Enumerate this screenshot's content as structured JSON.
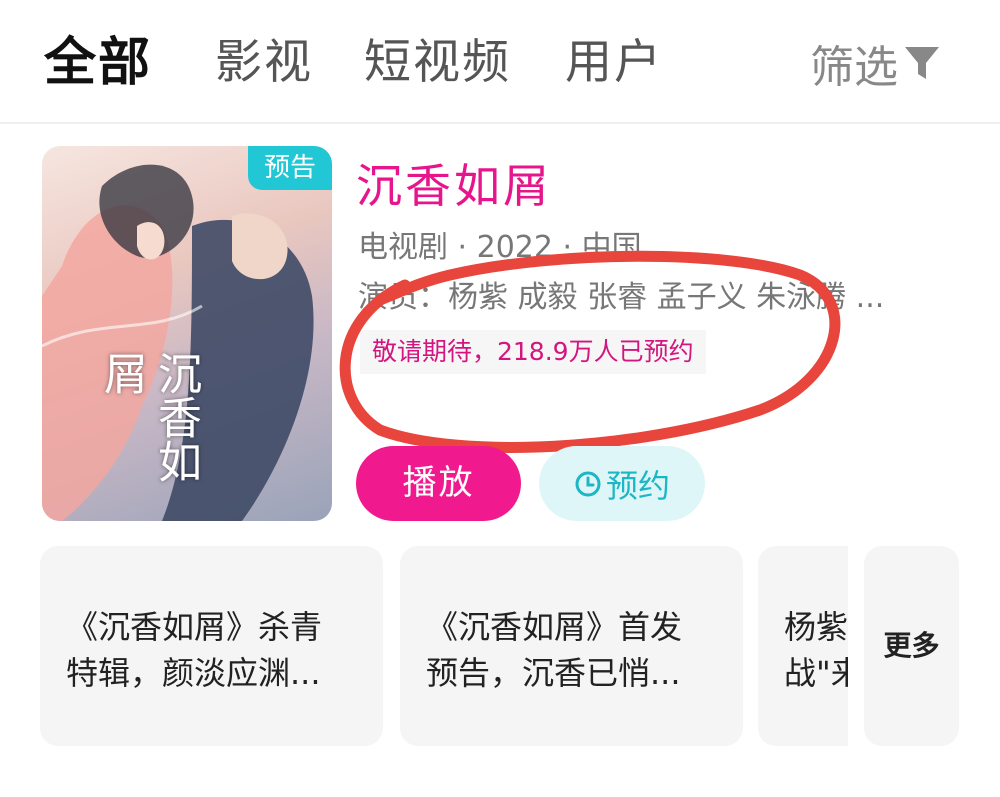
{
  "tabs": [
    {
      "label": "全部",
      "active": true
    },
    {
      "label": "影视",
      "active": false
    },
    {
      "label": "短视频",
      "active": false
    },
    {
      "label": "用户",
      "active": false
    }
  ],
  "filter": {
    "label": "筛选",
    "icon": "funnel-icon"
  },
  "result": {
    "badge": "预告",
    "title": "沉香如屑",
    "meta": "电视剧 · 2022 · 中国",
    "cast": "演员：杨紫 成毅 张睿 孟子义 朱泳腾 ...",
    "booking_status": "敬请期待，218.9万人已预约",
    "play_label": "播放",
    "reserve_label": "预约",
    "reserve_icon": "clock-icon",
    "poster_text": "沉香如屑"
  },
  "related": [
    {
      "line1": "《沉香如屑》杀青",
      "line2": "特辑，颜淡应渊..."
    },
    {
      "line1": "《沉香如屑》首发",
      "line2": "预告，沉香已悄..."
    },
    {
      "line1": "杨紫",
      "line2": "战\"来"
    }
  ],
  "more_label": "更多",
  "colors": {
    "accent_pink": "#f01a8e",
    "title_pink": "#e6158c",
    "teal": "#22c7d6",
    "annotation_red": "#e8453c"
  }
}
